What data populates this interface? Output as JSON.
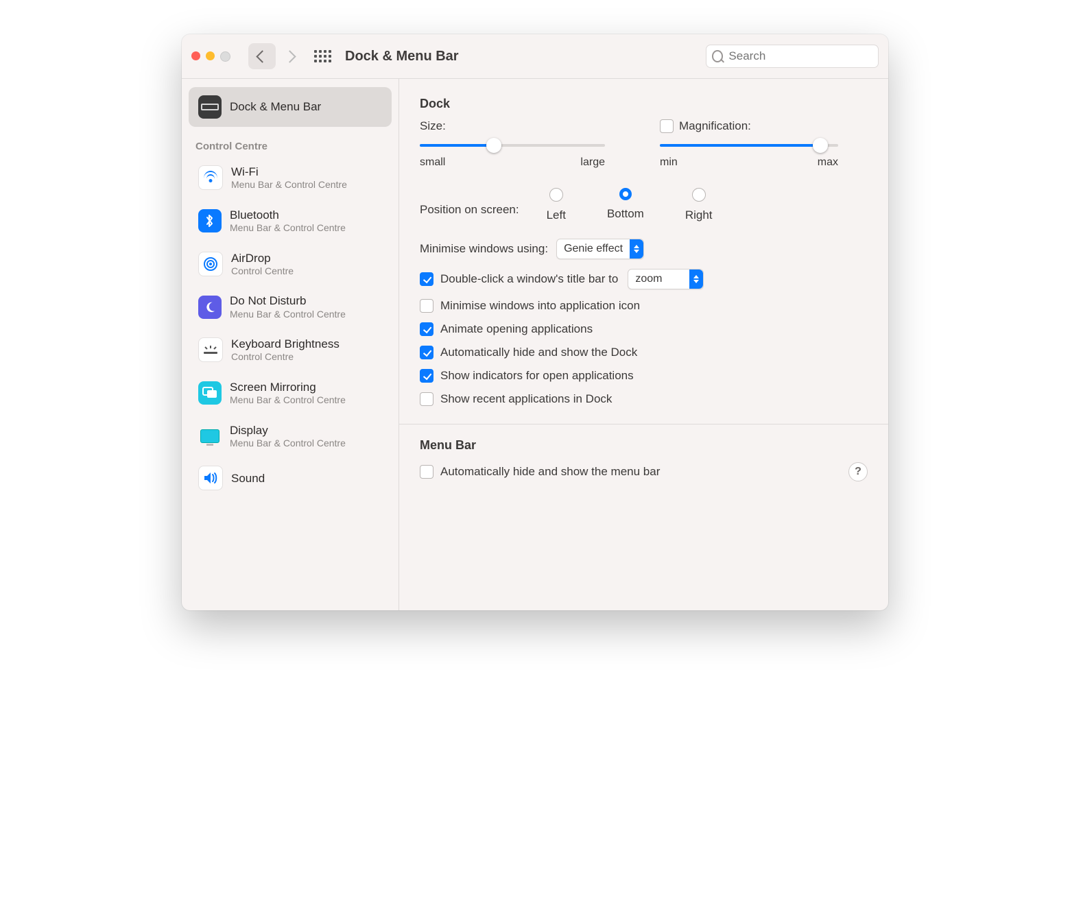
{
  "toolbar": {
    "title": "Dock & Menu Bar",
    "search_placeholder": "Search"
  },
  "sidebar": {
    "items": [
      {
        "label": "Dock & Menu Bar",
        "sub": ""
      }
    ],
    "control_centre_header": "Control Centre",
    "cc_items": [
      {
        "label": "Wi-Fi",
        "sub": "Menu Bar & Control Centre"
      },
      {
        "label": "Bluetooth",
        "sub": "Menu Bar & Control Centre"
      },
      {
        "label": "AirDrop",
        "sub": "Control Centre"
      },
      {
        "label": "Do Not Disturb",
        "sub": "Menu Bar & Control Centre"
      },
      {
        "label": "Keyboard Brightness",
        "sub": "Control Centre"
      },
      {
        "label": "Screen Mirroring",
        "sub": "Menu Bar & Control Centre"
      },
      {
        "label": "Display",
        "sub": "Menu Bar & Control Centre"
      },
      {
        "label": "Sound",
        "sub": ""
      }
    ]
  },
  "main": {
    "dock_section_title": "Dock",
    "size_label": "Size:",
    "size_min_label": "small",
    "size_max_label": "large",
    "size_value_percent": 40,
    "magnification_label": "Magnification:",
    "magnification_checked": false,
    "magnification_min_label": "min",
    "magnification_max_label": "max",
    "magnification_value_percent": 90,
    "position_label": "Position on screen:",
    "position_options": {
      "left": "Left",
      "bottom": "Bottom",
      "right": "Right"
    },
    "position_selected": "bottom",
    "minimise_label": "Minimise windows using:",
    "minimise_value": "Genie effect",
    "doubleclick_checked": true,
    "doubleclick_label": "Double-click a window's title bar to",
    "doubleclick_value": "zoom",
    "minimise_into_icon_checked": false,
    "minimise_into_icon_label": "Minimise windows into application icon",
    "animate_checked": true,
    "animate_label": "Animate opening applications",
    "autohide_dock_checked": true,
    "autohide_dock_label": "Automatically hide and show the Dock",
    "indicators_checked": true,
    "indicators_label": "Show indicators for open applications",
    "recent_checked": false,
    "recent_label": "Show recent applications in Dock",
    "menubar_section_title": "Menu Bar",
    "autohide_menubar_checked": false,
    "autohide_menubar_label": "Automatically hide and show the menu bar",
    "help_label": "?"
  }
}
